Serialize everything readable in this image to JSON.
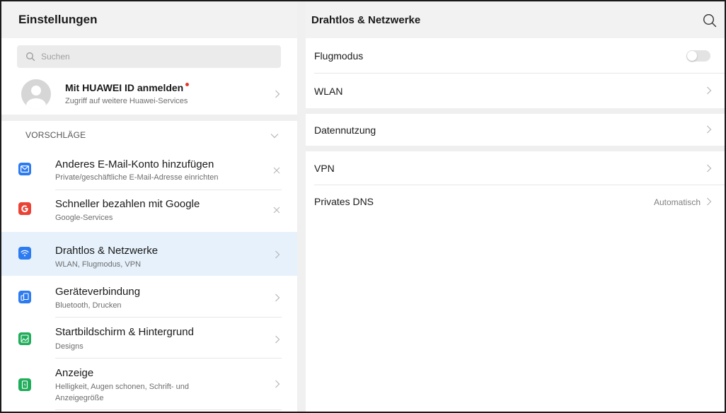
{
  "left": {
    "title": "Einstellungen",
    "search": {
      "placeholder": "Suchen"
    },
    "huawei": {
      "title": "Mit HUAWEI ID anmelden",
      "subtitle": "Zugriff auf weitere Huawei-Services",
      "badge_color": "#e8352b"
    },
    "suggestions_label": "VORSCHLÄGE",
    "suggestions": [
      {
        "title": "Anderes E-Mail-Konto hinzufügen",
        "subtitle": "Private/geschäftliche E-Mail-Adresse einrichten",
        "icon": "mail-icon",
        "color": "#2d7bf0"
      },
      {
        "title": "Schneller bezahlen mit Google",
        "subtitle": "Google-Services",
        "icon": "google-icon",
        "color": "#ea4335"
      }
    ],
    "items": [
      {
        "title": "Drahtlos & Netzwerke",
        "subtitle": "WLAN, Flugmodus, VPN",
        "icon": "wifi-icon",
        "color": "#2d7bf0",
        "selected": true
      },
      {
        "title": "Geräteverbindung",
        "subtitle": "Bluetooth, Drucken",
        "icon": "device-connection-icon",
        "color": "#2d7bf0"
      },
      {
        "title": "Startbildschirm & Hintergrund",
        "subtitle": "Designs",
        "icon": "wallpaper-icon",
        "color": "#1fad5a"
      },
      {
        "title": "Anzeige",
        "subtitle_line1": "Helligkeit, Augen schonen, Schrift- und",
        "subtitle_line2": "Anzeigegröße",
        "icon": "display-icon",
        "color": "#1fad5a"
      }
    ]
  },
  "right": {
    "title": "Drahtlos & Netzwerke",
    "rows": [
      {
        "label": "Flugmodus",
        "control": "toggle",
        "toggle_on": false
      },
      {
        "label": "WLAN",
        "control": "chevron"
      },
      {
        "label": "Datennutzung",
        "control": "chevron"
      },
      {
        "label": "VPN",
        "control": "chevron"
      },
      {
        "label": "Privates DNS",
        "control": "chevron",
        "value": "Automatisch"
      }
    ]
  }
}
